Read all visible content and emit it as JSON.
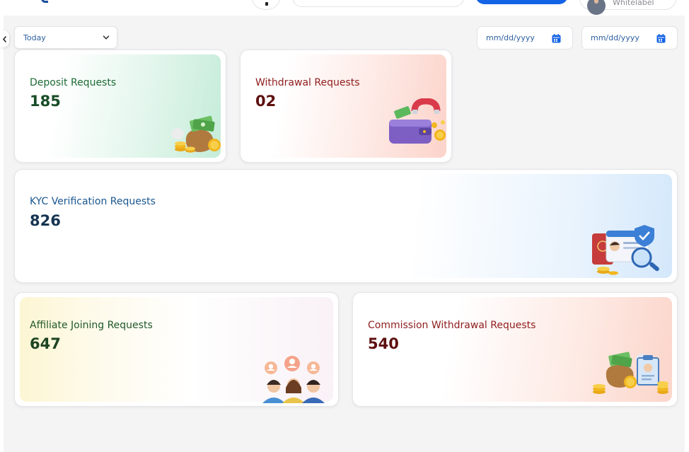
{
  "header": {
    "profile_name": "Whitelabel"
  },
  "filters": {
    "period": {
      "selected": "Today"
    },
    "start_date": {
      "placeholder": "mm/dd/yyyy"
    },
    "end_date": {
      "placeholder": "mm/dd/yyyy"
    }
  },
  "stats": [
    {
      "label": "Deposit Requests",
      "value": "185",
      "icon": "money-bag-icon",
      "accent": "#1e6b35"
    },
    {
      "label": "Withdrawal Requests",
      "value": "02",
      "icon": "wallet-magnet-icon",
      "accent": "#8f1d1d"
    },
    {
      "label": "KYC Verification Requests",
      "value": "826",
      "icon": "id-verification-icon",
      "accent": "#1a5690"
    },
    {
      "label": "Affiliate Joining Requests",
      "value": "647",
      "icon": "people-group-icon",
      "accent": "#20582a"
    },
    {
      "label": "Commission Withdrawal Requests",
      "value": "540",
      "icon": "commission-clipboard-icon",
      "accent": "#8f1d1d"
    }
  ]
}
